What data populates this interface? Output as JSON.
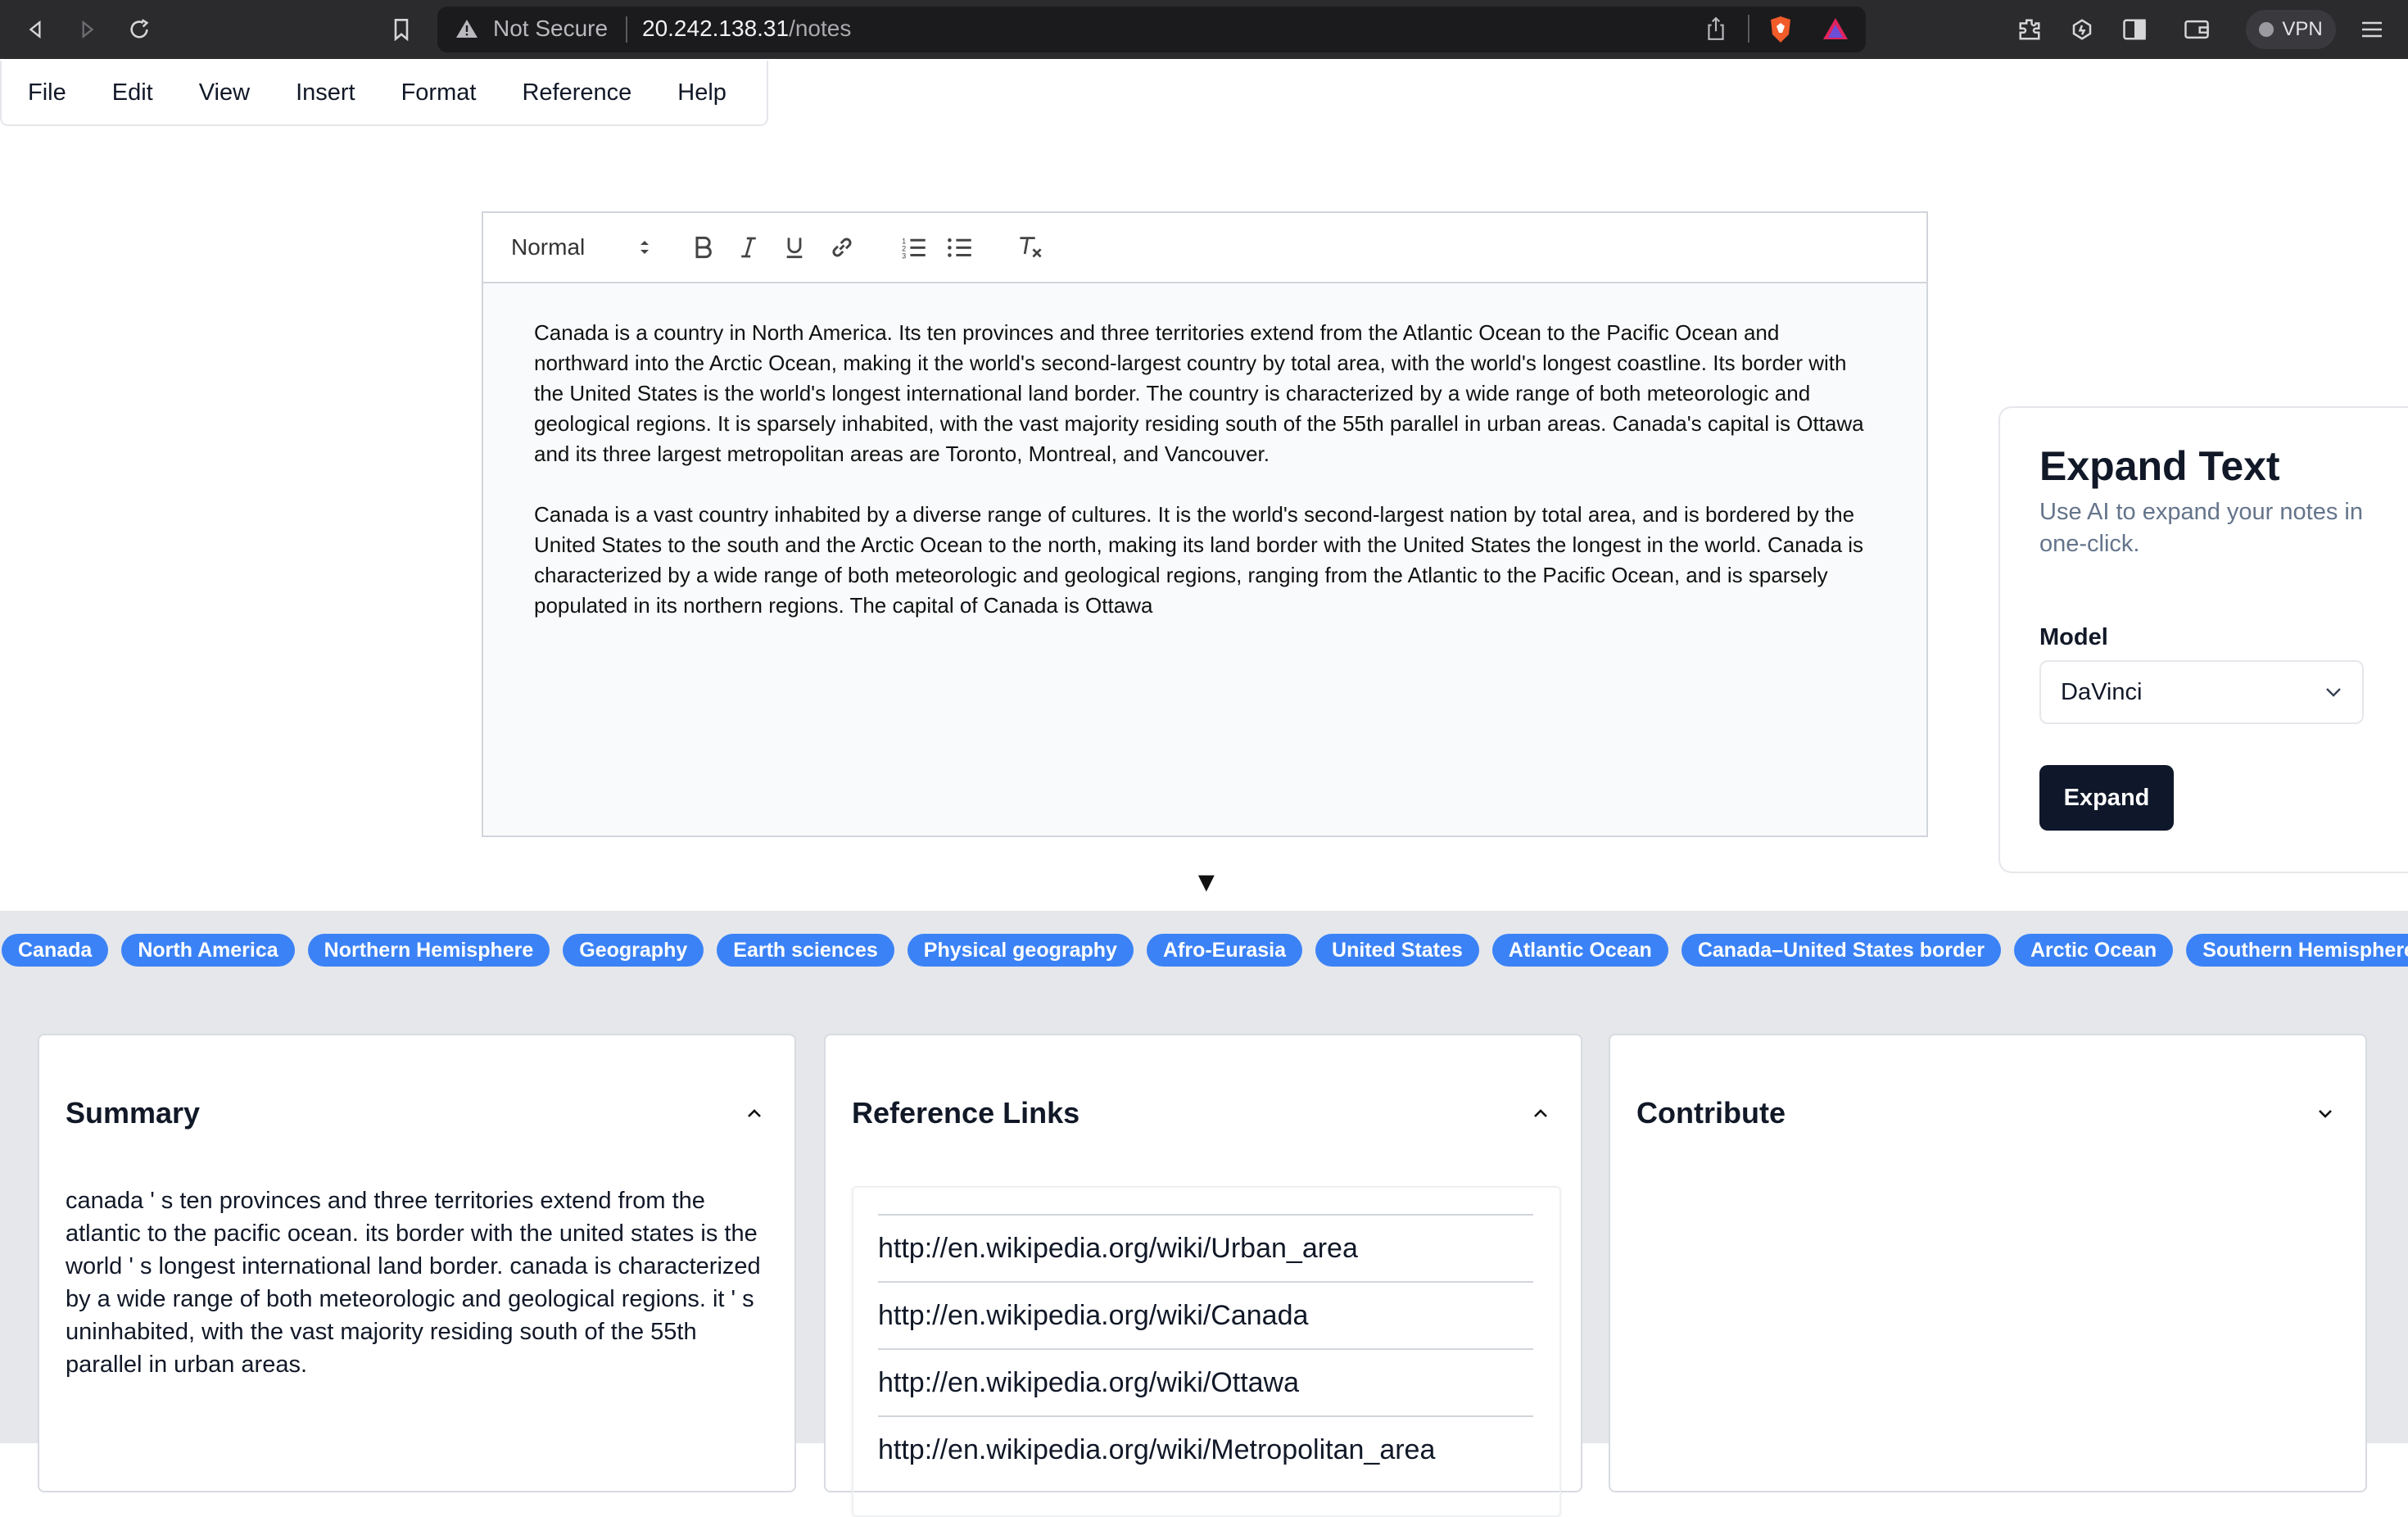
{
  "browser": {
    "not_secure": "Not Secure",
    "url_host": "20.242.138.31",
    "url_path": "/notes",
    "vpn_label": "VPN"
  },
  "menu": [
    "File",
    "Edit",
    "View",
    "Insert",
    "Format",
    "Reference",
    "Help"
  ],
  "editor": {
    "format_select": "Normal",
    "paragraphs": [
      "Canada is a country in North America. Its ten provinces and three territories extend from the Atlantic Ocean to the Pacific Ocean and northward into the Arctic Ocean, making it the world's second-largest country by total area, with the world's longest coastline. Its border with the United States is the world's longest international land border. The country is characterized by a wide range of both meteorologic and geological regions. It is sparsely inhabited, with the vast majority residing south of the 55th parallel in urban areas. Canada's capital is Ottawa and its three largest metropolitan areas are Toronto, Montreal, and Vancouver.",
      "Canada is a vast country inhabited by a diverse range of cultures. It is the world's second-largest nation by total area, and is bordered by the United States to the south and the Arctic Ocean to the north, making its land border with the United States the longest in the world. Canada is characterized by a wide range of both meteorologic and geological regions, ranging from the Atlantic to the Pacific Ocean, and is sparsely populated in its northern regions. The capital of Canada is Ottawa"
    ],
    "toggle_glyph": "▼"
  },
  "expand": {
    "title": "Expand Text",
    "subtitle": "Use AI to expand your notes in one-click.",
    "model_label": "Model",
    "model_value": "DaVinci",
    "button": "Expand"
  },
  "tags": [
    "Canada",
    "North America",
    "Northern Hemisphere",
    "Geography",
    "Earth sciences",
    "Physical geography",
    "Afro-Eurasia",
    "United States",
    "Atlantic Ocean",
    "Canada–United States border",
    "Arctic Ocean",
    "Southern Hemisphere"
  ],
  "cards": {
    "summary": {
      "title": "Summary",
      "text": "canada ' s ten provinces and three territories extend from the atlantic to the pacific ocean. its border with the united states is the world ' s longest international land border. canada is characterized by a wide range of both meteorologic and geological regions. it ' s uninhabited, with the vast majority residing south of the 55th parallel in urban areas."
    },
    "references": {
      "title": "Reference Links",
      "links": [
        "http://en.wikipedia.org/wiki/Urban_area",
        "http://en.wikipedia.org/wiki/Canada",
        "http://en.wikipedia.org/wiki/Ottawa",
        "http://en.wikipedia.org/wiki/Metropolitan_area"
      ]
    },
    "contribute": {
      "title": "Contribute"
    }
  }
}
